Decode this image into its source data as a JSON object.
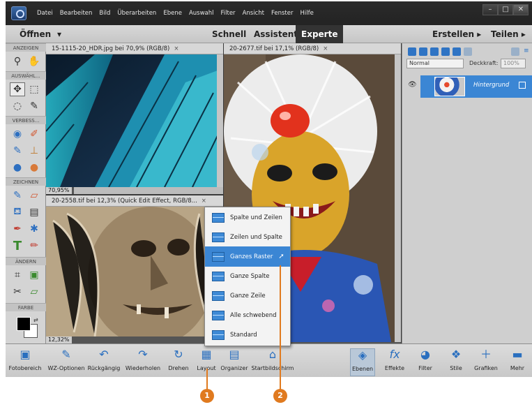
{
  "menubar": {
    "items": [
      "Datei",
      "Bearbeiten",
      "Bild",
      "Überarbeiten",
      "Ebene",
      "Auswahl",
      "Filter",
      "Ansicht",
      "Fenster",
      "Hilfe"
    ],
    "window_buttons": [
      "–",
      "□",
      "✕"
    ]
  },
  "modebar": {
    "open": "Öffnen",
    "open_arrow": "▾",
    "modes": [
      "Schnell",
      "Assistent",
      "Experte"
    ],
    "active_mode": "Experte",
    "create": "Erstellen ▸",
    "share": "Teilen ▸"
  },
  "toolbox": {
    "sections": [
      "ANZEIGEN",
      "AUSWÄHL...",
      "VERBESS...",
      "ZEICHNEN",
      "ÄNDERN",
      "FARBE"
    ]
  },
  "documents": {
    "doc1": {
      "tab": "15-1115-20_HDR.jpg bei 70,9% (RGB/8)",
      "zoom": "70,95%"
    },
    "doc2": {
      "tab": "20-2677.tif bei 17,1% (RGB/8)"
    },
    "doc3": {
      "tab": "20-2558.tif bei 12,3% (Quick Edit Effect, RGB/8...",
      "zoom": "12,32%"
    },
    "close": "×"
  },
  "layers_panel": {
    "blend_mode": "Normal",
    "opacity_label": "Deckkraft:",
    "opacity_value": "100%",
    "layer_name": "Hintergrund"
  },
  "bottombar": {
    "buttons": [
      "Fotobereich",
      "WZ-Optionen",
      "Rückgängig",
      "Wiederholen",
      "Drehen",
      "Layout",
      "Organizer",
      "Startbildschirm",
      "Ebenen",
      "Effekte",
      "Filter",
      "Stile",
      "Grafiken",
      "Mehr"
    ]
  },
  "layout_menu": {
    "items": [
      "Spalte und Zeilen",
      "Zeilen und Spalte",
      "Ganzes Raster",
      "Ganze Spalte",
      "Ganze Zeile",
      "Alle schwebend",
      "Standard"
    ],
    "highlighted": "Ganzes Raster"
  },
  "callouts": [
    "1",
    "2"
  ],
  "colors": {
    "accent_blue": "#3b86d4",
    "callout_orange": "#e07a1f"
  }
}
